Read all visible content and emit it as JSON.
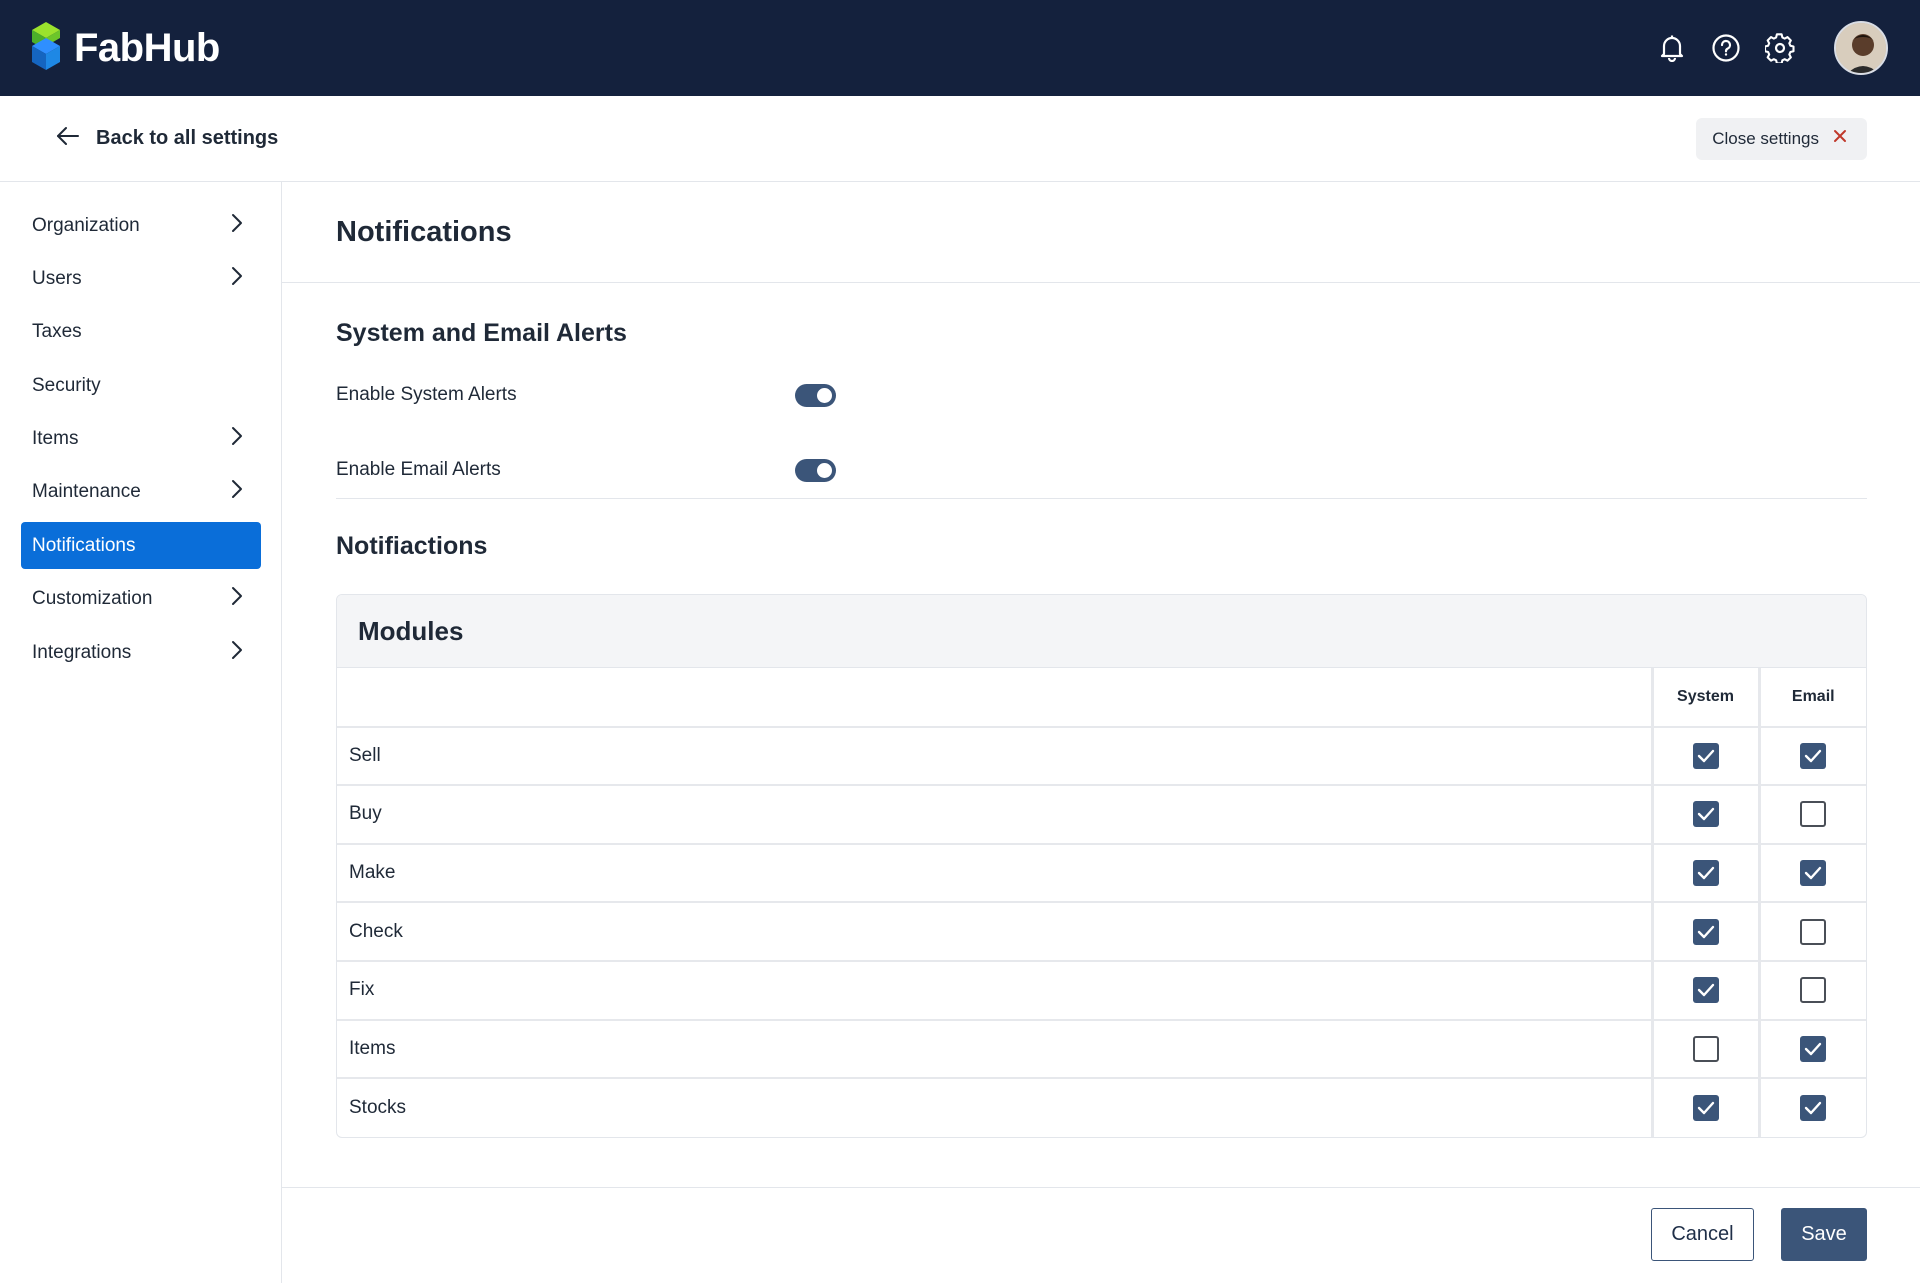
{
  "app": {
    "brand": "FabHub"
  },
  "topbar": {
    "icons": [
      "bell-icon",
      "help-icon",
      "gear-icon"
    ]
  },
  "subheader": {
    "back_label": "Back to all settings",
    "close_label": "Close settings"
  },
  "sidebar": {
    "items": [
      {
        "label": "Organization",
        "has_chevron": true
      },
      {
        "label": "Users",
        "has_chevron": true
      },
      {
        "label": "Taxes",
        "has_chevron": false
      },
      {
        "label": "Security",
        "has_chevron": false
      },
      {
        "label": "Items",
        "has_chevron": true
      },
      {
        "label": "Maintenance",
        "has_chevron": true
      },
      {
        "label": "Notifications",
        "has_chevron": false,
        "active": true
      },
      {
        "label": "Customization",
        "has_chevron": true
      },
      {
        "label": "Integrations",
        "has_chevron": true
      }
    ]
  },
  "main": {
    "page_title": "Notifications",
    "alerts": {
      "heading": "System and Email Alerts",
      "system_label": "Enable System Alerts",
      "system_enabled": true,
      "email_label": "Enable Email Alerts",
      "email_enabled": true
    },
    "notifications_heading": "Notifiactions",
    "table": {
      "title": "Modules",
      "col_system": "System",
      "col_email": "Email",
      "rows": [
        {
          "module": "Sell",
          "system": true,
          "email": true
        },
        {
          "module": "Buy",
          "system": true,
          "email": false
        },
        {
          "module": "Make",
          "system": true,
          "email": true
        },
        {
          "module": "Check",
          "system": true,
          "email": false
        },
        {
          "module": "Fix",
          "system": true,
          "email": false
        },
        {
          "module": "Items",
          "system": false,
          "email": true
        },
        {
          "module": "Stocks",
          "system": true,
          "email": true
        }
      ]
    }
  },
  "footer": {
    "cancel_label": "Cancel",
    "save_label": "Save"
  },
  "colors": {
    "topbar_bg": "#14213d",
    "active_nav": "#0a6ed9",
    "accent": "#3b5579"
  }
}
